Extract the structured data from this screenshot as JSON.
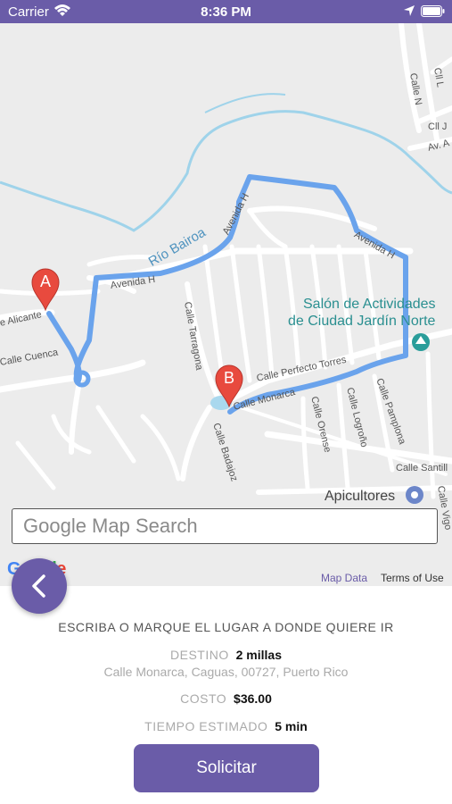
{
  "status_bar": {
    "carrier": "Carrier",
    "time": "8:36 PM"
  },
  "map": {
    "streets": {
      "alicante": "e Alicante",
      "cuenca": "Calle Cuenca",
      "avenida_h_1": "Avenida H",
      "avenida_h_2": "Avenida H",
      "avenida_h_3": "Avenida H",
      "rio_bairoa": "Río Bairoa",
      "tarragona": "Calle Tarragona",
      "perfecto_torres": "Calle Perfecto Torres",
      "monarca": "Calle Monarca",
      "badajoz": "Calle Badajoz",
      "orense": "Calle Orense",
      "logrono": "Calle Logroño",
      "pamplona": "Calle Pamplona",
      "santill": "Calle Santill",
      "vigo": "Calle Vigo",
      "cll_n": "Calle N",
      "cll_l": "Cll L",
      "cll_j": "Cll J",
      "av_a": "Av. A"
    },
    "pois": {
      "salon_line1": "Salón de Actividades",
      "salon_line2": "de Ciudad Jardín Norte",
      "apicultores": "Apicultores"
    },
    "markers": {
      "a": "A",
      "b": "B"
    },
    "search_placeholder": "Google Map Search",
    "map_data_link": "Map Data",
    "terms_link": "Terms of Use"
  },
  "panel": {
    "instruction": "ESCRIBA O MARQUE EL LUGAR A DONDE QUIERE IR",
    "destino_label": "DESTINO",
    "destino_value": "2 millas",
    "address": "Calle Monarca, Caguas, 00727, Puerto Rico",
    "costo_label": "COSTO",
    "costo_value": "$36.00",
    "tiempo_label": "TIEMPO ESTIMADO",
    "tiempo_value": "5 min",
    "request_button": "Solicitar"
  },
  "colors": {
    "primary": "#6a5ca8",
    "route": "#5f9fe8",
    "river": "#8fcbe8",
    "marker": "#e84a3e",
    "poi": "#2a8f90"
  }
}
